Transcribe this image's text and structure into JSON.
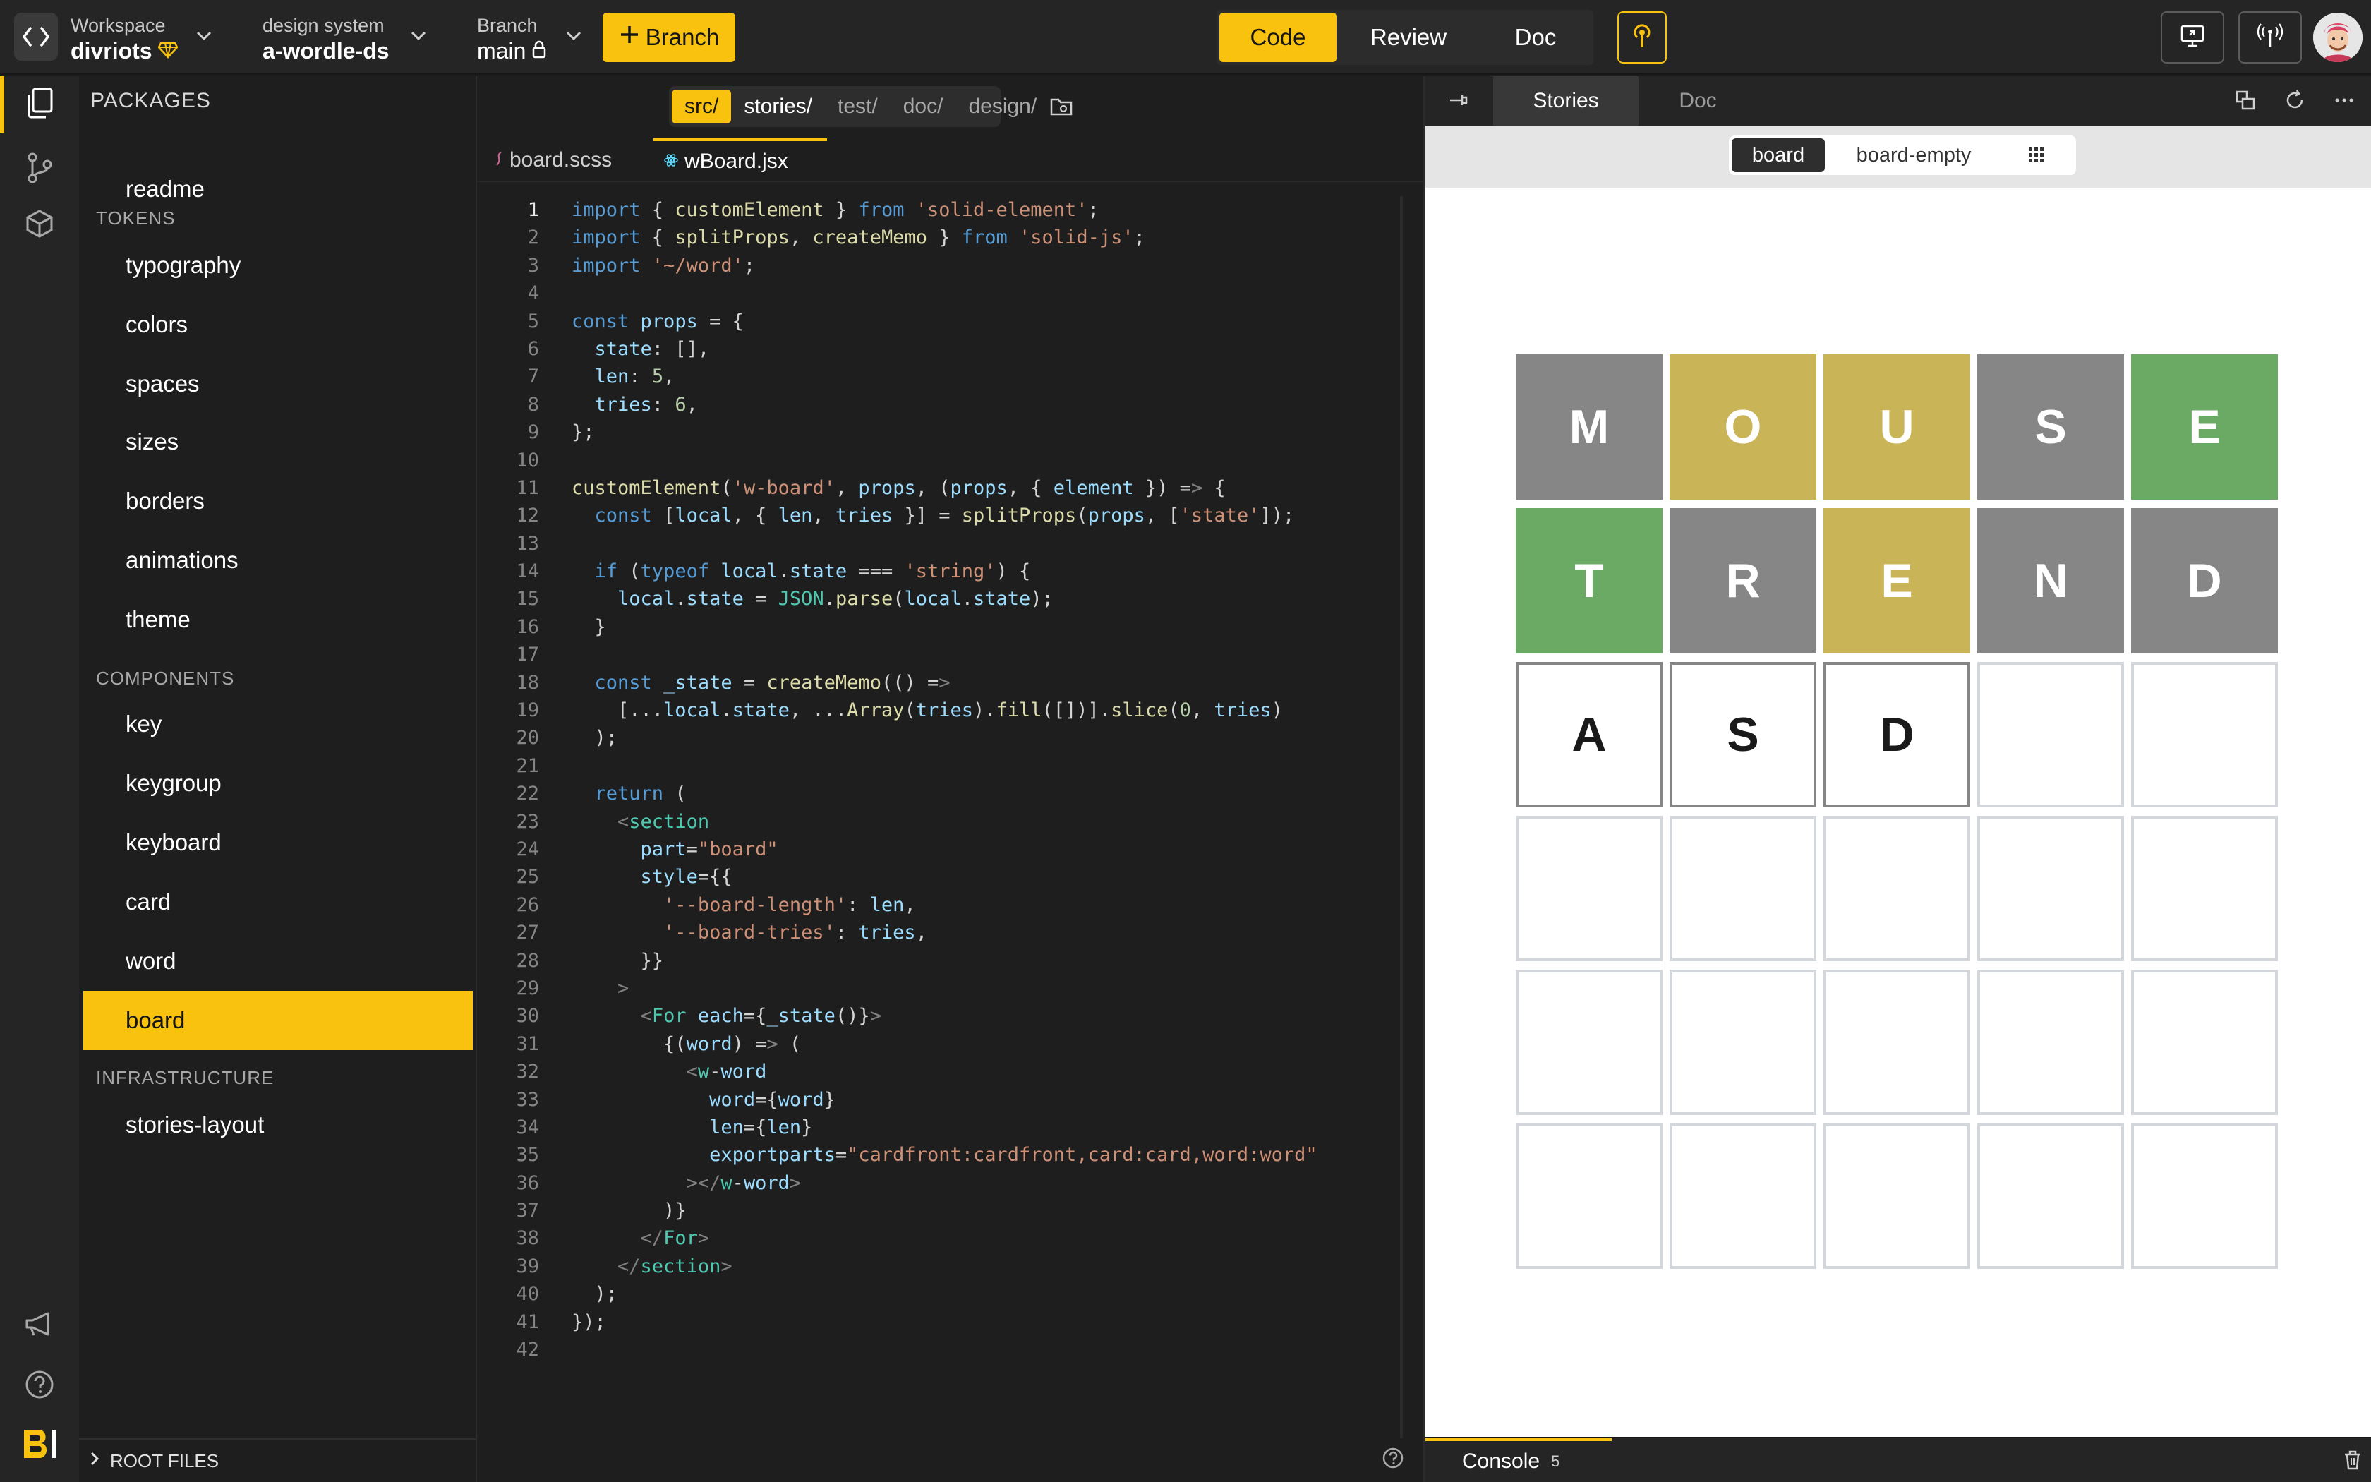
{
  "topbar": {
    "workspace_label": "Workspace",
    "workspace_value": "divriots",
    "design_system_label": "design system",
    "design_system_value": "a-wordle-ds",
    "branch_label": "Branch",
    "branch_value": "main",
    "branch_button": "Branch",
    "modes": [
      "Code",
      "Review",
      "Doc"
    ],
    "active_mode": "Code"
  },
  "sidebar": {
    "title": "PACKAGES",
    "top_items": [
      {
        "label": "readme"
      }
    ],
    "sections": [
      {
        "title": "TOKENS",
        "items": [
          "typography",
          "colors",
          "spaces",
          "sizes",
          "borders",
          "animations",
          "theme"
        ]
      },
      {
        "title": "COMPONENTS",
        "items": [
          "key",
          "keygroup",
          "keyboard",
          "card",
          "word",
          "board"
        ]
      },
      {
        "title": "INFRASTRUCTURE",
        "items": [
          "stories-layout"
        ]
      }
    ],
    "active_item": "board",
    "bottom_label": "ROOT FILES"
  },
  "editor": {
    "folders": [
      "src/",
      "stories/",
      "test/",
      "doc/",
      "design/"
    ],
    "active_folder": "src/",
    "files": [
      "board.scss",
      "wBoard.jsx"
    ],
    "active_file": "wBoard.jsx",
    "lines": [
      "import { customElement } from 'solid-element';",
      "import { splitProps, createMemo } from 'solid-js';",
      "import '~/word';",
      "",
      "const props = {",
      "  state: [],",
      "  len: 5,",
      "  tries: 6,",
      "};",
      "",
      "customElement('w-board', props, (props, { element }) => {",
      "  const [local, { len, tries }] = splitProps(props, ['state']);",
      "",
      "  if (typeof local.state === 'string') {",
      "    local.state = JSON.parse(local.state);",
      "  }",
      "",
      "  const _state = createMemo(() =>",
      "    [...local.state, ...Array(tries).fill([])].slice(0, tries)",
      "  );",
      "",
      "  return (",
      "    <section",
      "      part=\"board\"",
      "      style={{",
      "        '--board-length': len,",
      "        '--board-tries': tries,",
      "      }}",
      "    >",
      "      <For each={_state()}>",
      "        {(word) => (",
      "          <w-word",
      "            word={word}",
      "            len={len}",
      "            exportparts=\"cardfront:cardfront,card:card,word:word\"",
      "          ></w-word>",
      "        )}",
      "      </For>",
      "    </section>",
      "  );",
      "});",
      ""
    ]
  },
  "preview": {
    "tabs": [
      "Stories",
      "Doc"
    ],
    "active_tab": "Stories",
    "stories": [
      "board",
      "board-empty"
    ],
    "active_story": "board",
    "board_rows": [
      [
        {
          "letter": "M",
          "state": "gray"
        },
        {
          "letter": "O",
          "state": "yellow"
        },
        {
          "letter": "U",
          "state": "yellow"
        },
        {
          "letter": "S",
          "state": "gray"
        },
        {
          "letter": "E",
          "state": "green"
        }
      ],
      [
        {
          "letter": "T",
          "state": "green"
        },
        {
          "letter": "R",
          "state": "gray"
        },
        {
          "letter": "E",
          "state": "yellow"
        },
        {
          "letter": "N",
          "state": "gray"
        },
        {
          "letter": "D",
          "state": "gray"
        }
      ],
      [
        {
          "letter": "A",
          "state": "typed"
        },
        {
          "letter": "S",
          "state": "typed"
        },
        {
          "letter": "D",
          "state": "typed"
        },
        {
          "letter": "",
          "state": "empty"
        },
        {
          "letter": "",
          "state": "empty"
        }
      ],
      [
        {
          "letter": "",
          "state": "empty"
        },
        {
          "letter": "",
          "state": "empty"
        },
        {
          "letter": "",
          "state": "empty"
        },
        {
          "letter": "",
          "state": "empty"
        },
        {
          "letter": "",
          "state": "empty"
        }
      ],
      [
        {
          "letter": "",
          "state": "empty"
        },
        {
          "letter": "",
          "state": "empty"
        },
        {
          "letter": "",
          "state": "empty"
        },
        {
          "letter": "",
          "state": "empty"
        },
        {
          "letter": "",
          "state": "empty"
        }
      ],
      [
        {
          "letter": "",
          "state": "empty"
        },
        {
          "letter": "",
          "state": "empty"
        },
        {
          "letter": "",
          "state": "empty"
        },
        {
          "letter": "",
          "state": "empty"
        },
        {
          "letter": "",
          "state": "empty"
        }
      ]
    ],
    "console_label": "Console",
    "console_count": "5"
  },
  "colors": {
    "accent": "#f8c20f",
    "tile_gray": "#868686",
    "tile_yellow": "#c9b458",
    "tile_green": "#6aaa64"
  }
}
